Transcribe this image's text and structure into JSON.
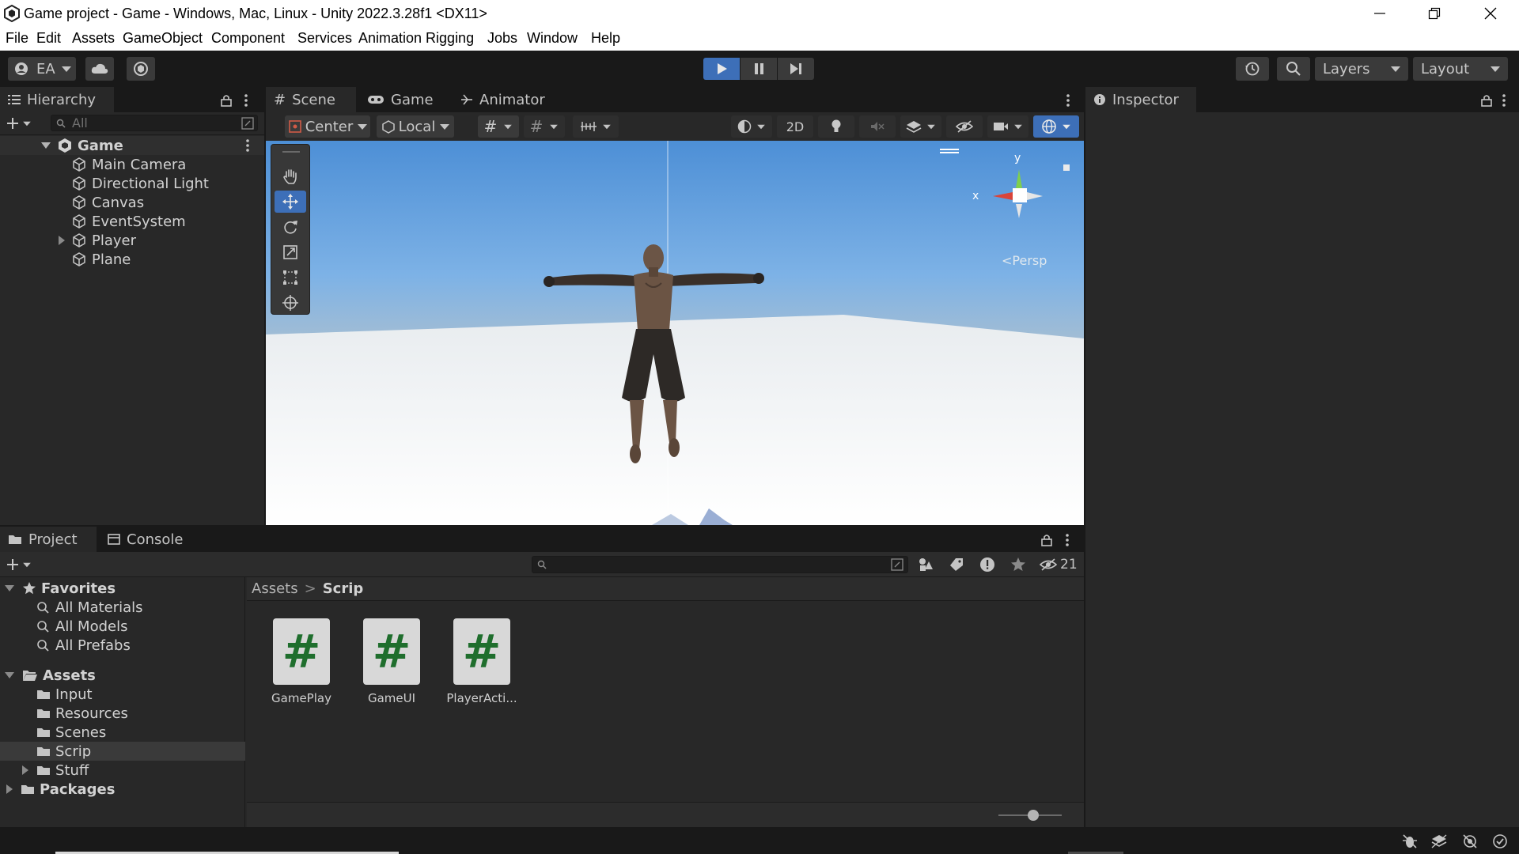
{
  "window": {
    "title": "Game project - Game - Windows, Mac, Linux - Unity 2022.3.28f1 <DX11>"
  },
  "menu": [
    "File",
    "Edit",
    "Assets",
    "GameObject",
    "Component",
    "Services",
    "Animation Rigging",
    "Jobs",
    "Window",
    "Help"
  ],
  "toolbar": {
    "account_label": "EA",
    "layers_label": "Layers",
    "layout_label": "Layout"
  },
  "hierarchy": {
    "tab_label": "Hierarchy",
    "search_placeholder": "All",
    "scene_name": "Game",
    "items": [
      "Main Camera",
      "Directional Light",
      "Canvas",
      "EventSystem",
      "Player",
      "Plane"
    ]
  },
  "scene_tabs": {
    "scene": "Scene",
    "game": "Game",
    "animator": "Animator"
  },
  "scene_toolbar": {
    "pivot_label": "Center",
    "space_label": "Local",
    "mode_2d": "2D"
  },
  "gizmo": {
    "axis_y": "y",
    "axis_x": "x",
    "projection": "Persp"
  },
  "inspector": {
    "tab_label": "Inspector"
  },
  "project": {
    "tab_project": "Project",
    "tab_console": "Console",
    "hidden_count": "21",
    "favorites_label": "Favorites",
    "favorites": [
      "All Materials",
      "All Models",
      "All Prefabs"
    ],
    "assets_label": "Assets",
    "asset_folders": [
      "Input",
      "Resources",
      "Scenes",
      "Scrip",
      "Stuff"
    ],
    "packages_label": "Packages",
    "breadcrumb": [
      "Assets",
      "Scrip"
    ],
    "files": [
      "GamePlay",
      "GameUI",
      "PlayerActi..."
    ],
    "file_icon_glyph": "#",
    "zoom_level": 0.55
  },
  "colors": {
    "accent_blue": "#3d6fb8",
    "script_green": "#1f6e2d"
  }
}
